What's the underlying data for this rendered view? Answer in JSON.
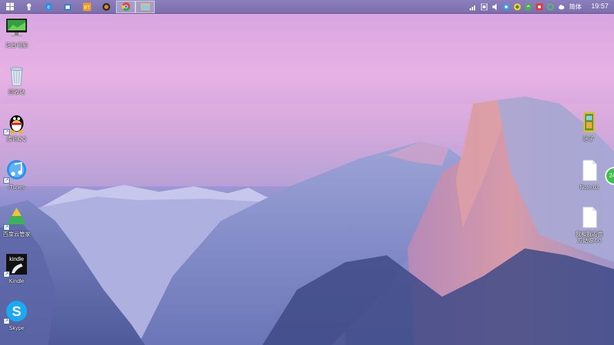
{
  "taskbar": {
    "pinned": [
      {
        "name": "start-icon",
        "color": "#ffffff"
      },
      {
        "name": "ie-icon",
        "color": "#3c8fe0"
      },
      {
        "name": "store-icon",
        "color": "#2a7fd4"
      },
      {
        "name": "bt-icon",
        "color": "#f09a24"
      },
      {
        "name": "media-icon",
        "color": "#e06a10"
      },
      {
        "name": "chrome-icon",
        "color": "#e7453c"
      },
      {
        "name": "explorer-icon",
        "color": "#e8c25a"
      }
    ],
    "tray": {
      "ime_label": "简体",
      "time": "19:57"
    }
  },
  "desktop": {
    "left_icons": [
      {
        "id": "computer",
        "label": "这台电脑",
        "icon": "monitor-icon"
      },
      {
        "id": "recycle",
        "label": "回收站",
        "icon": "recycle-bin-icon"
      },
      {
        "id": "qq",
        "label": "腾讯QQ",
        "icon": "qq-penguin-icon"
      },
      {
        "id": "itunes",
        "label": "iTunes",
        "icon": "itunes-icon"
      },
      {
        "id": "baiduyun",
        "label": "百度云管家",
        "icon": "baidu-cloud-icon"
      },
      {
        "id": "kindle",
        "label": "Kindle",
        "icon": "kindle-icon",
        "badge": "kindle"
      },
      {
        "id": "skype",
        "label": "Skype",
        "icon": "skype-icon",
        "badge": "S"
      }
    ],
    "right_icons": [
      {
        "id": "folder",
        "label": "贴子",
        "icon": "folder-icon"
      },
      {
        "id": "note",
        "label": "Note.txt",
        "icon": "text-file-icon"
      },
      {
        "id": "txt2",
        "label": "我和我的南方姑娘.txt",
        "icon": "text-file-icon"
      }
    ],
    "edge_badge": "24"
  },
  "colors": {
    "taskbar": "#7b6fae",
    "sky_top": "#d6a3e2",
    "mountain": "#8e93c8"
  }
}
